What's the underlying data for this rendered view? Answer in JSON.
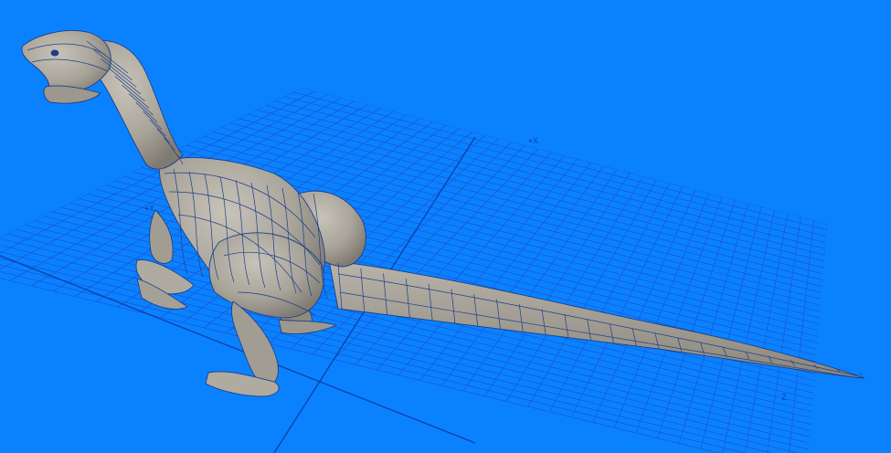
{
  "viewport": {
    "background": "#0a82ff",
    "grid_color": "#1a5ad8",
    "grid_major_color": "#0b3fa8",
    "mesh_fill": "#a9a49a",
    "mesh_line": "#1d3f8a"
  },
  "axes": {
    "x_label": "+X",
    "y_label": "+Y",
    "z_label": "Z"
  },
  "model": {
    "subject": "dinosaur-wireframe-mesh"
  }
}
